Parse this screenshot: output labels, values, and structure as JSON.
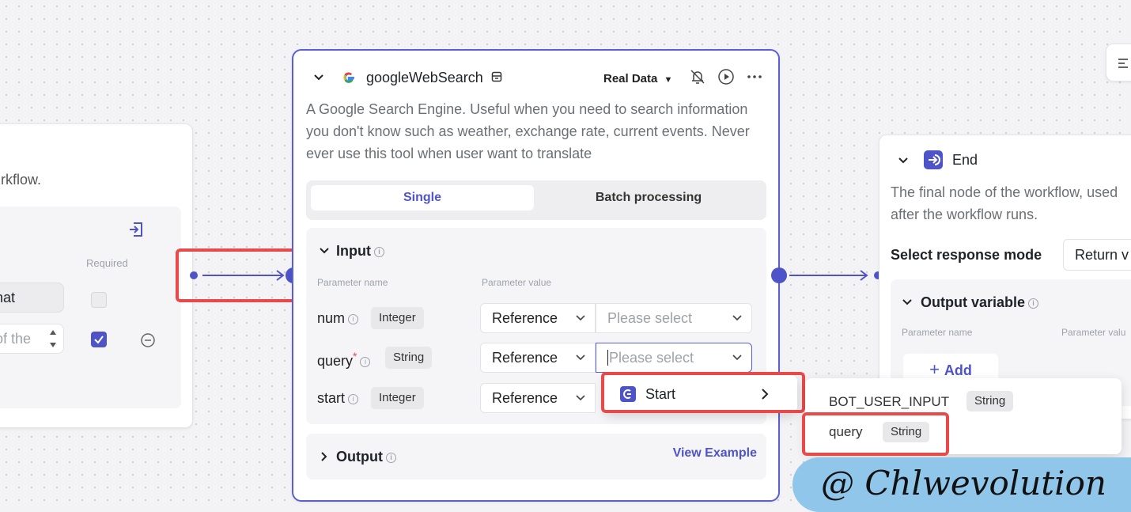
{
  "left_node": {
    "desc_fragment": "rkflow.",
    "col_required": "Required",
    "row1_value": "hat",
    "row2_value": "of the"
  },
  "main_node": {
    "title": "googleWebSearch",
    "mode_label": "Real Data",
    "description": "A Google Search Engine. Useful when you need to search information you don't know such as weather, exchange rate, current events. Never ever use this tool when user want to translate",
    "tabs": [
      "Single",
      "Batch processing"
    ],
    "input_title": "Input",
    "col_param_name": "Parameter name",
    "col_param_value": "Parameter value",
    "params": [
      {
        "name": "num",
        "type": "Integer",
        "mode": "Reference",
        "value_placeholder": "Please select",
        "required": false
      },
      {
        "name": "query",
        "type": "String",
        "mode": "Reference",
        "value_placeholder": "Please select",
        "required": true
      },
      {
        "name": "start",
        "type": "Integer",
        "mode": "Reference",
        "value_placeholder": "",
        "required": false
      }
    ],
    "required_mark": "*",
    "output_title": "Output",
    "view_example": "View Example"
  },
  "end_node": {
    "title": "End",
    "description_l1": "The final node of the workflow, used",
    "description_l2": "after the workflow runs.",
    "response_mode_label": "Select response mode",
    "response_mode_value": "Return v",
    "output_title": "Output variable",
    "col_param_name": "Parameter name",
    "col_param_value": "Parameter valu",
    "add_label": "Add"
  },
  "ref_dropdown": {
    "item": "Start"
  },
  "var_dropdown": {
    "items": [
      {
        "name": "BOT_USER_INPUT",
        "type": "String"
      },
      {
        "name": "query",
        "type": "String"
      }
    ]
  },
  "watermark": "@ Chlwevolution",
  "colors": {
    "accent": "#4e54c8",
    "highlight": "#e84a4a"
  }
}
